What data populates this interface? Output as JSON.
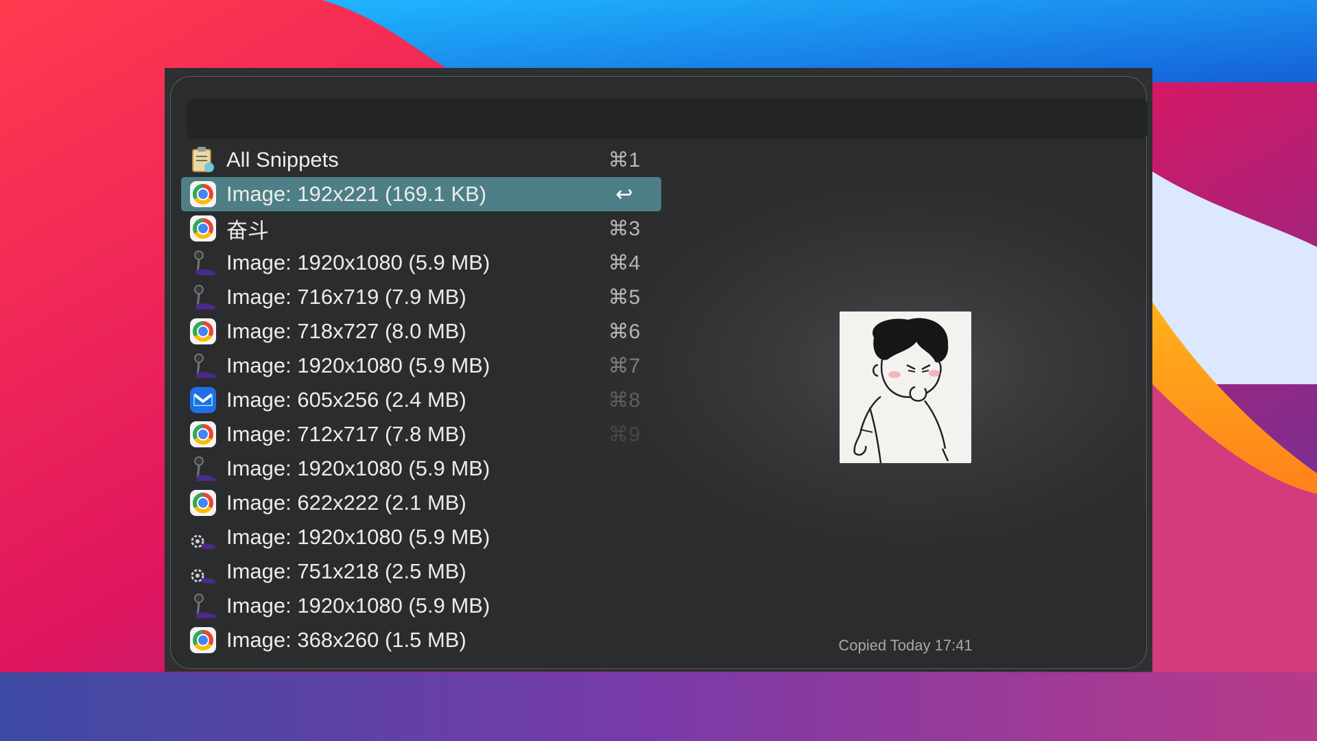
{
  "list": {
    "items": [
      {
        "icon": "snippets-icon",
        "label": "All Snippets",
        "shortcut": "⌘1",
        "selected": false
      },
      {
        "icon": "chrome-icon",
        "label": "Image: 192x221 (169.1 KB)",
        "shortcut": "↩",
        "selected": true
      },
      {
        "icon": "chrome-icon",
        "label": "奋斗",
        "shortcut": "⌘3",
        "selected": false
      },
      {
        "icon": "screenshot-tool-icon",
        "label": "Image: 1920x1080 (5.9 MB)",
        "shortcut": "⌘4",
        "selected": false
      },
      {
        "icon": "screenshot-tool-icon",
        "label": "Image: 716x719 (7.9 MB)",
        "shortcut": "⌘5",
        "selected": false
      },
      {
        "icon": "chrome-icon",
        "label": "Image: 718x727 (8.0 MB)",
        "shortcut": "⌘6",
        "selected": false
      },
      {
        "icon": "screenshot-tool-icon",
        "label": "Image: 1920x1080 (5.9 MB)",
        "shortcut": "⌘7",
        "selected": false
      },
      {
        "icon": "mail-app-icon",
        "label": "Image: 605x256 (2.4 MB)",
        "shortcut": "⌘8",
        "selected": false
      },
      {
        "icon": "chrome-icon",
        "label": "Image: 712x717 (7.8 MB)",
        "shortcut": "⌘9",
        "selected": false
      },
      {
        "icon": "screenshot-tool-icon",
        "label": "Image: 1920x1080 (5.9 MB)",
        "shortcut": "",
        "selected": false
      },
      {
        "icon": "chrome-icon",
        "label": "Image: 622x222 (2.1 MB)",
        "shortcut": "",
        "selected": false
      },
      {
        "icon": "gear-tool-icon",
        "label": "Image: 1920x1080 (5.9 MB)",
        "shortcut": "",
        "selected": false
      },
      {
        "icon": "gear-tool-icon",
        "label": "Image: 751x218 (2.5 MB)",
        "shortcut": "",
        "selected": false
      },
      {
        "icon": "screenshot-tool-icon",
        "label": "Image: 1920x1080 (5.9 MB)",
        "shortcut": "",
        "selected": false
      },
      {
        "icon": "chrome-icon",
        "label": "Image: 368x260 (1.5 MB)",
        "shortcut": "",
        "selected": false
      }
    ]
  },
  "preview": {
    "image": "cartoon-boy-thinking",
    "copied_text": "Copied Today 17:41"
  },
  "colors": {
    "selection": "#4e7f86",
    "panel": "#2f3032",
    "search_bar": "#232426"
  }
}
